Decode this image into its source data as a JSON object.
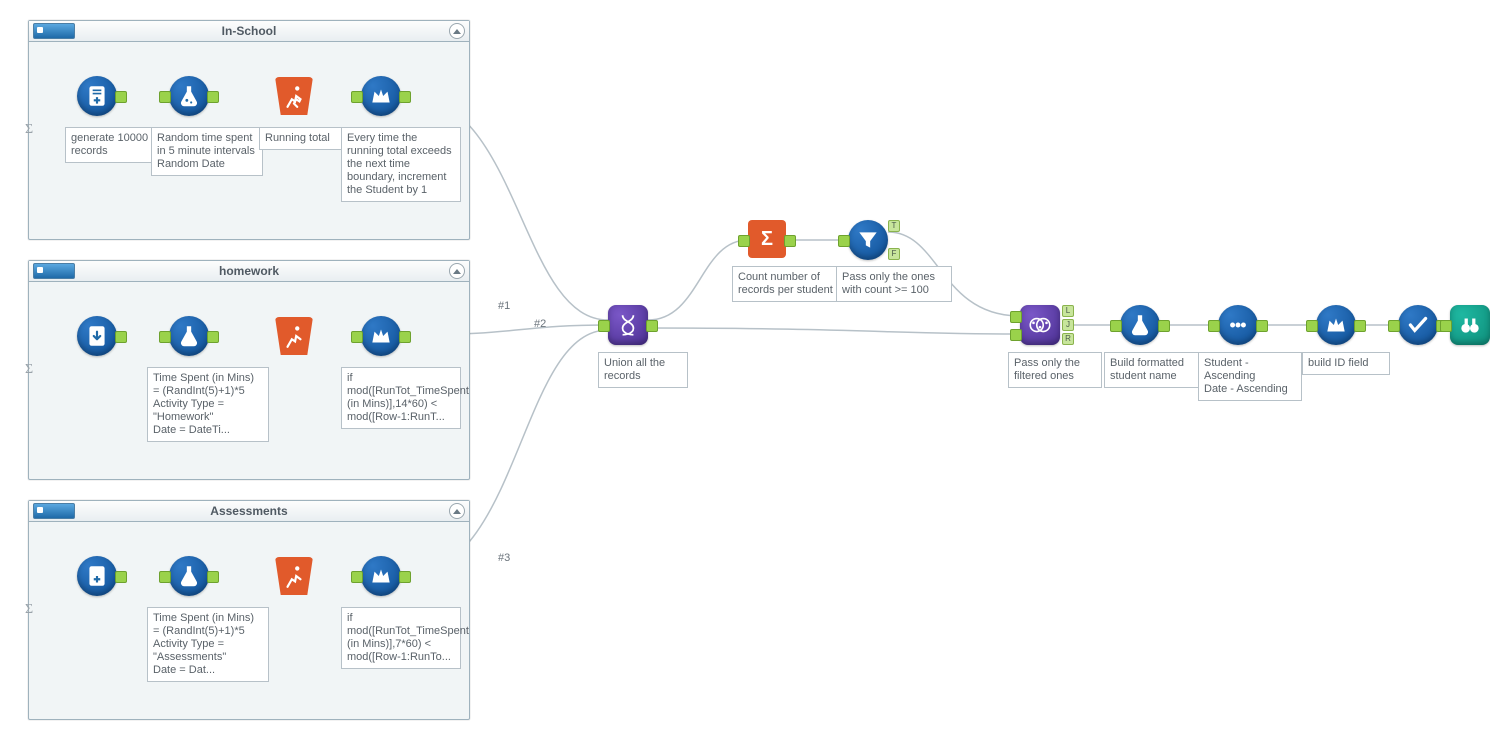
{
  "containers": {
    "inSchool": {
      "title": "In-School",
      "tools": {
        "generate": {
          "label": "generate 10000 records"
        },
        "formula": {
          "label": "Random time spent in 5 minute intervals\nRandom Date"
        },
        "running": {
          "label": "Running total"
        },
        "multirow": {
          "label": "Every time the running total exceeds the next time boundary, increment the Student by 1"
        }
      }
    },
    "homework": {
      "title": "homework",
      "tools": {
        "formula": {
          "label": "Time Spent (in Mins) = (RandInt(5)+1)*5\nActivity Type = \"Homework\"\nDate = DateTi..."
        },
        "multirow": {
          "label": "if mod([RunTot_TimeSpent (in Mins)],14*60) < mod([Row-1:RunT..."
        }
      }
    },
    "assessments": {
      "title": "Assessments",
      "tools": {
        "formula": {
          "label": "Time Spent (in Mins) = (RandInt(5)+1)*5\nActivity Type = \"Assessments\"\nDate = Dat..."
        },
        "multirow": {
          "label": "if mod([RunTot_TimeSpent (in Mins)],7*60) < mod([Row-1:RunTo..."
        }
      }
    }
  },
  "pipeline": {
    "union": {
      "label": "Union all the records"
    },
    "summarize": {
      "label": "Count number of records per student"
    },
    "filter": {
      "label": "Pass only the ones with count >= 100"
    },
    "join": {
      "label": "Pass only the filtered ones"
    },
    "formula": {
      "label": "Build formatted student name"
    },
    "select": {
      "label": ""
    },
    "sort": {
      "label": "Student - Ascending\nDate - Ascending"
    },
    "multirow": {
      "label": "build ID field"
    },
    "browse": {
      "label": ""
    }
  },
  "edgeLabels": {
    "e1": "#1",
    "e2": "#2",
    "e3": "#3"
  }
}
